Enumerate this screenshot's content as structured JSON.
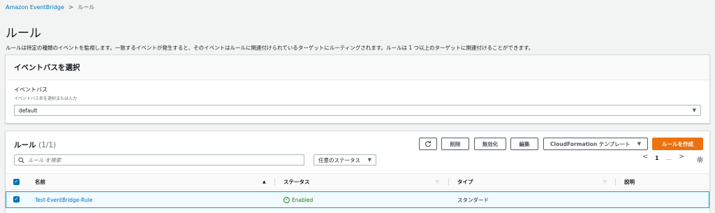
{
  "breadcrumb": {
    "parent": "Amazon EventBridge",
    "separator": ">",
    "current": "ルール"
  },
  "page": {
    "title": "ルール",
    "description": "ルールは特定の種類のイベントを監視します。一致するイベントが発生すると、そのイベントはルールに関連付けられているターゲットにルーティングされます。ルールは 1 つ以上のターゲットに関連付けることができます。"
  },
  "event_bus": {
    "header": "イベントバスを選択",
    "label": "イベントバス",
    "description": "イベントバス名を選択または入力",
    "selected": "default"
  },
  "rules": {
    "title": "ルール",
    "count": "(1/1)",
    "buttons": {
      "refresh_icon": "refresh-icon",
      "delete": "削除",
      "disable": "無効化",
      "edit": "編集",
      "cloudformation": "CloudFormation テンプレート",
      "create": "ルールを作成"
    },
    "search_placeholder": "ルール を検索",
    "status_filter": "任意のステータス",
    "pagination": {
      "prev": "<",
      "page": "1",
      "ellipsis": "...",
      "next": ">"
    },
    "columns": [
      "名前",
      "ステータス",
      "タイプ",
      "説明"
    ],
    "rows": [
      {
        "name": "Test-EventBridge-Rule",
        "status": "Enabled",
        "type": "スタンダード",
        "description": "",
        "selected": true
      }
    ]
  },
  "colors": {
    "primary": "#ec7211",
    "link": "#0073bb",
    "enabled": "#1d8102",
    "selected_row_border": "#00a1c9"
  }
}
